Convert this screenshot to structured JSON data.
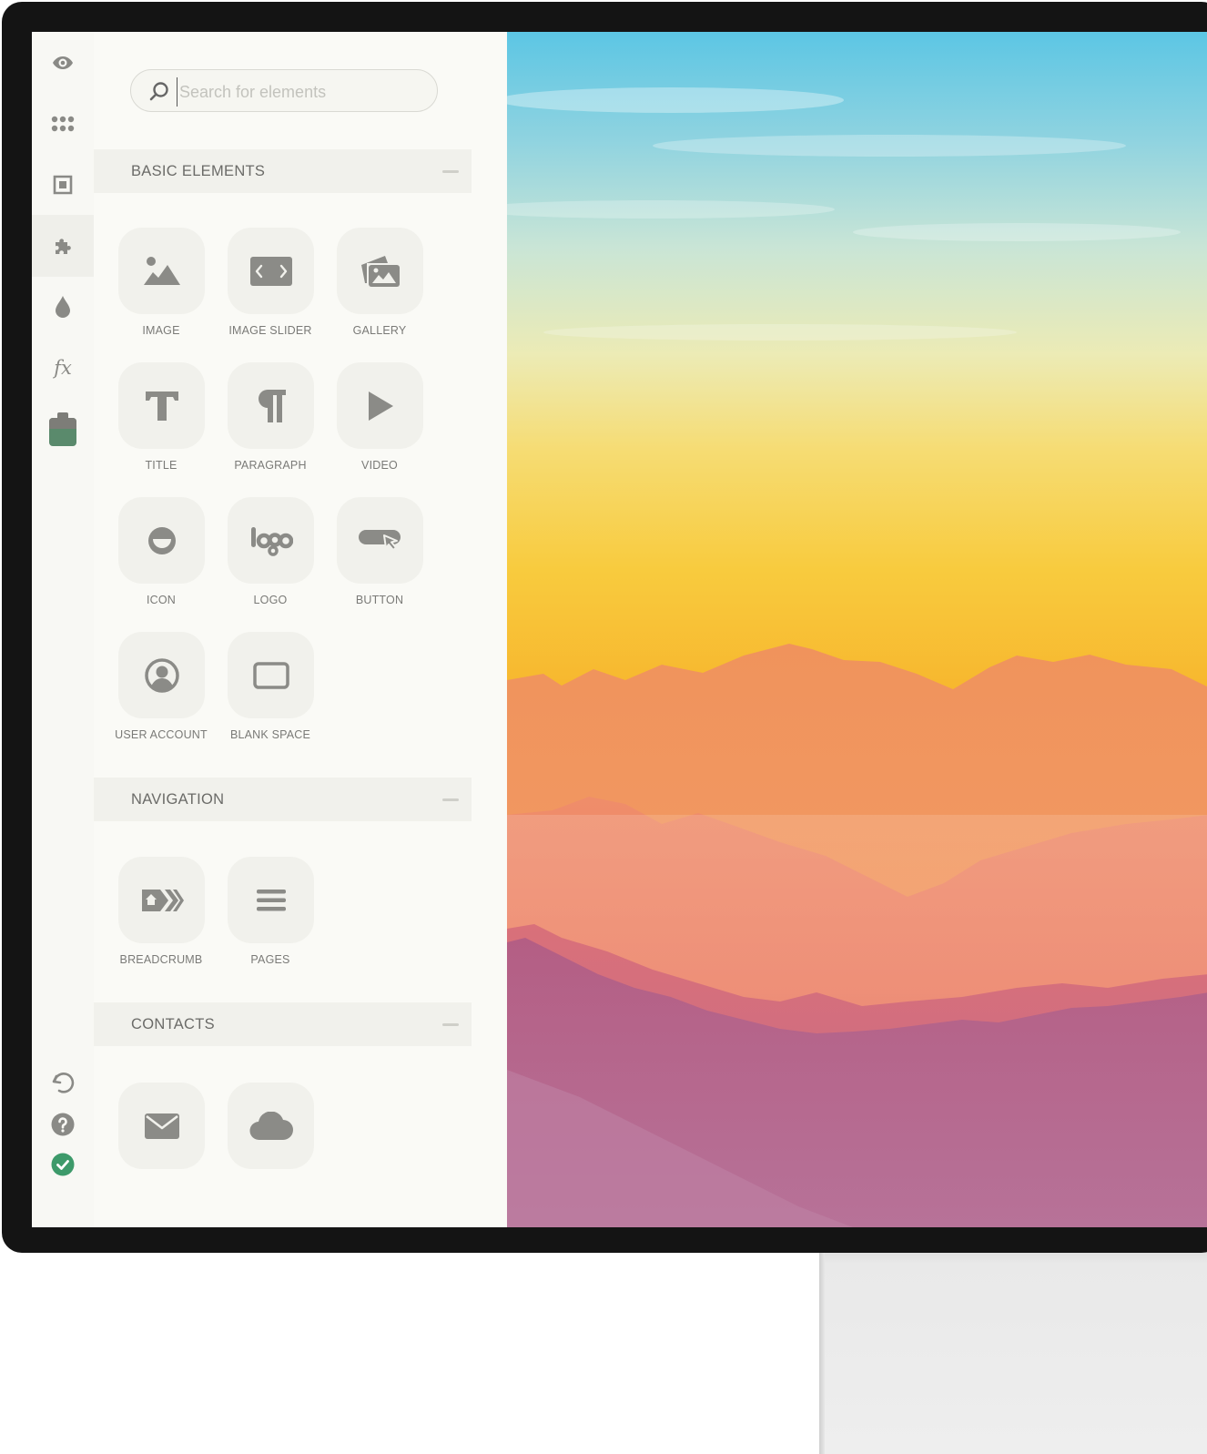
{
  "search": {
    "placeholder": "Search for elements"
  },
  "rail": {
    "top": [
      {
        "icon": "eye-icon"
      },
      {
        "icon": "grid-dots-icon"
      },
      {
        "icon": "frame-icon"
      },
      {
        "icon": "puzzle-icon",
        "active": true
      },
      {
        "icon": "drop-icon"
      },
      {
        "icon": "fx-icon",
        "text": "fx"
      },
      {
        "icon": "store-bag-icon",
        "color": "#5a8a6c"
      }
    ],
    "bottom": [
      {
        "icon": "undo-icon"
      },
      {
        "icon": "help-icon"
      },
      {
        "icon": "check-circle-icon",
        "color": "#3d9a6a"
      }
    ]
  },
  "sections": [
    {
      "title": "BASIC ELEMENTS",
      "items": [
        {
          "label": "IMAGE",
          "icon": "image-icon"
        },
        {
          "label": "IMAGE SLIDER",
          "icon": "image-slider-icon"
        },
        {
          "label": "GALLERY",
          "icon": "gallery-icon"
        },
        {
          "label": "TITLE",
          "icon": "title-icon"
        },
        {
          "label": "PARAGRAPH",
          "icon": "paragraph-icon"
        },
        {
          "label": "VIDEO",
          "icon": "video-icon"
        },
        {
          "label": "ICON",
          "icon": "smiley-icon"
        },
        {
          "label": "LOGO",
          "icon": "logo-icon"
        },
        {
          "label": "BUTTON",
          "icon": "button-icon"
        },
        {
          "label": "USER ACCOUNT",
          "icon": "user-account-icon"
        },
        {
          "label": "BLANK SPACE",
          "icon": "blank-space-icon"
        }
      ]
    },
    {
      "title": "NAVIGATION",
      "items": [
        {
          "label": "BREADCRUMB",
          "icon": "breadcrumb-icon"
        },
        {
          "label": "PAGES",
          "icon": "pages-icon"
        }
      ]
    },
    {
      "title": "CONTACTS",
      "items": [
        {
          "label": "",
          "icon": "mail-icon"
        },
        {
          "label": "",
          "icon": "cloud-icon"
        }
      ]
    }
  ],
  "colors": {
    "accent_green": "#3d9a6a",
    "icon_gray": "#8b8b87",
    "bezel": "#141414"
  }
}
